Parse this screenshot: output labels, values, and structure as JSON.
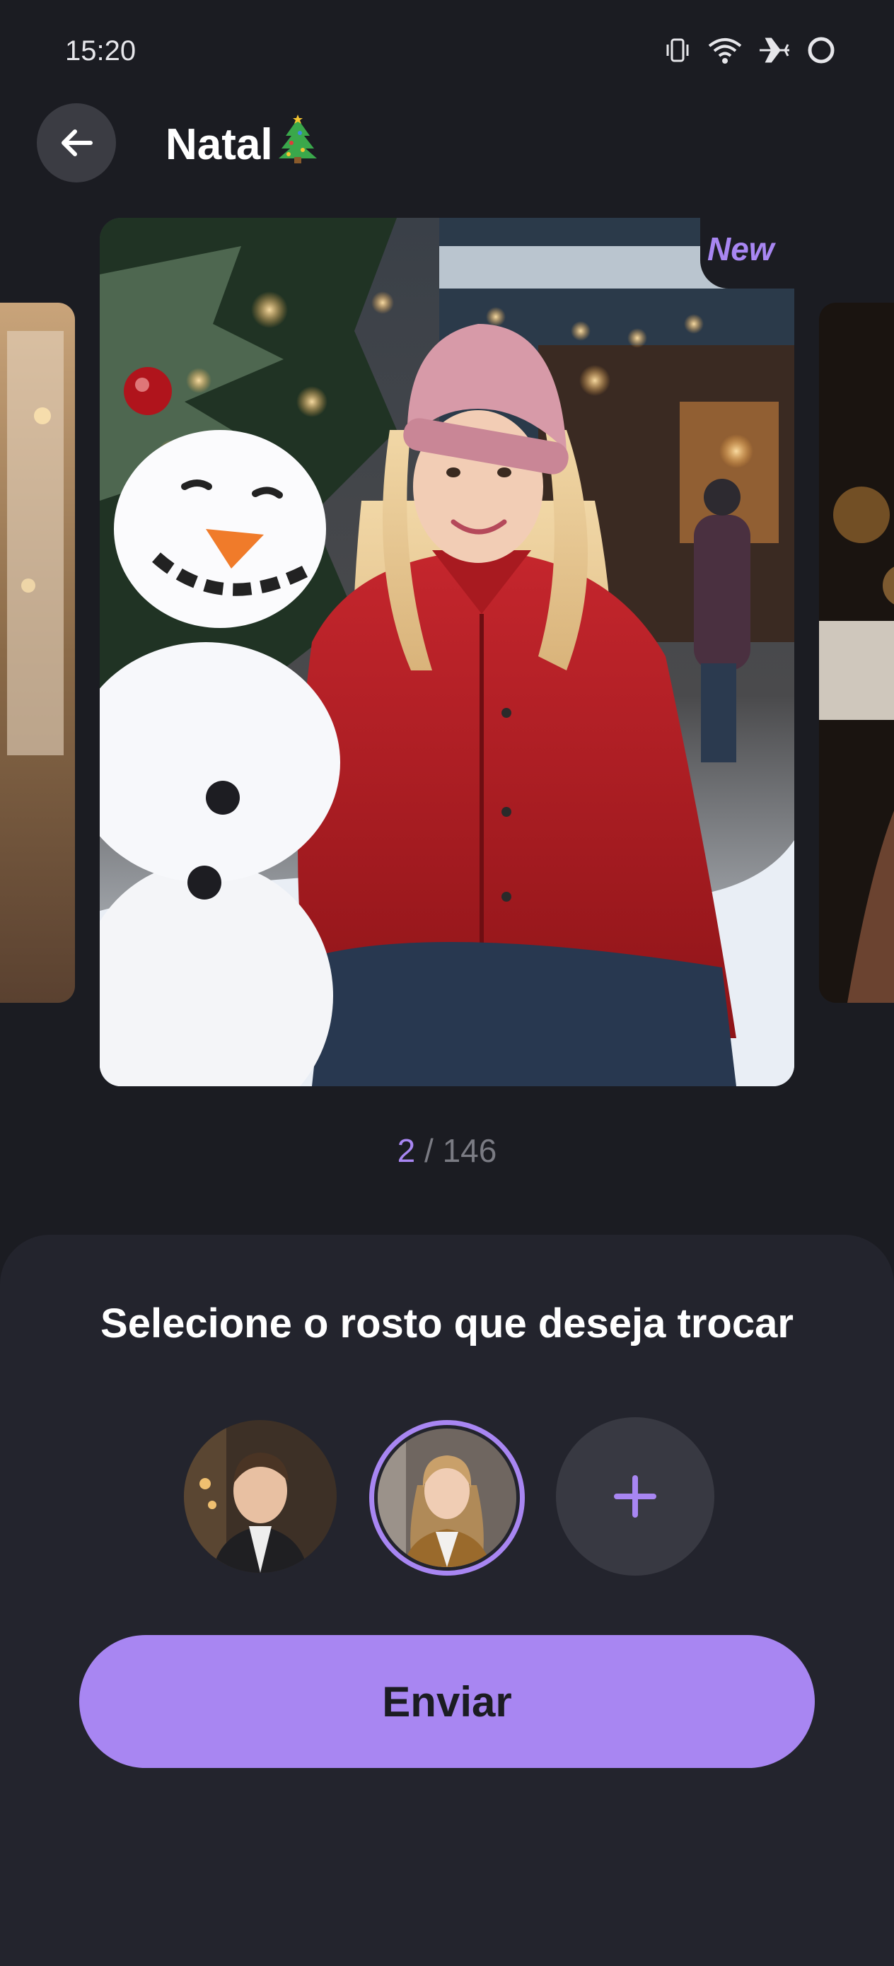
{
  "status_bar": {
    "time": "15:20",
    "icons": [
      "vibrate-icon",
      "wifi-icon",
      "airplane-icon",
      "battery-ring-icon"
    ]
  },
  "header": {
    "title": "Natal",
    "title_emoji": "christmas-tree-icon",
    "back_icon": "arrow-left-icon"
  },
  "carousel": {
    "badge": "New",
    "current": "2",
    "separator": "/",
    "total": "146"
  },
  "sheet": {
    "title": "Selecione o rosto que deseja trocar",
    "faces": [
      "face-man-avatar",
      "face-woman-avatar"
    ],
    "selected_face_index": 1,
    "add_icon": "plus-icon",
    "send_label": "Enviar"
  },
  "colors": {
    "background": "#1b1c22",
    "sheet": "#23242d",
    "accent": "#a886f2"
  }
}
